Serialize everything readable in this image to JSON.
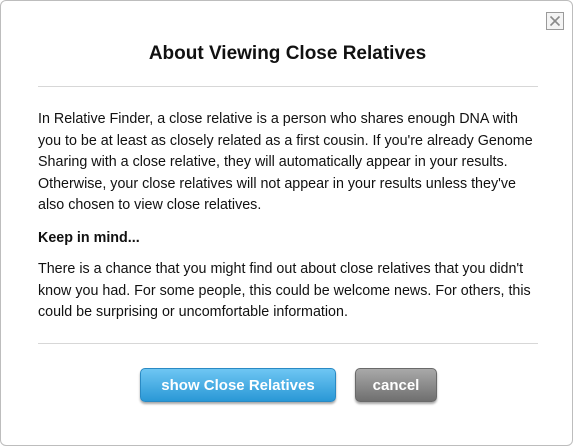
{
  "dialog": {
    "title": "About Viewing Close Relatives",
    "intro": "In Relative Finder, a close relative is a person who shares enough DNA with you to be at least as closely related as a first cousin. If you're already Genome Sharing with a close relative, they will automatically appear in your results. Otherwise, your close relatives will not appear in your results unless they've also chosen to view close relatives.",
    "subhead": "Keep in mind...",
    "warning": "There is a chance that you might find out about close relatives that you didn't know you had. For some people, this could be welcome news. For others, this could be surprising or uncomfortable information.",
    "close_icon": "close-icon"
  },
  "buttons": {
    "primary_label": "show Close Relatives",
    "secondary_label": "cancel"
  },
  "colors": {
    "primary_button": "#2a98d6",
    "secondary_button": "#6f6f6f"
  }
}
